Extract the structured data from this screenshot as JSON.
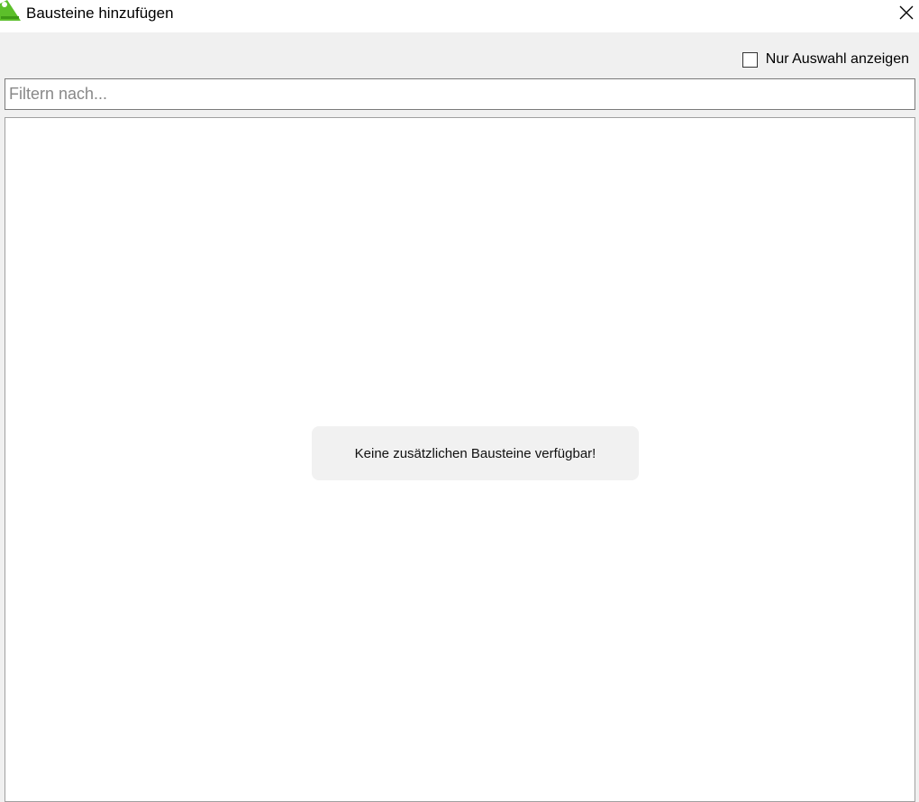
{
  "window": {
    "title": "Bausteine hinzufügen",
    "app_icon": "codesys-logo-icon",
    "close_icon": "close-icon"
  },
  "options": {
    "show_selection_only_label": "Nur Auswahl anzeigen",
    "show_selection_only_checked": false
  },
  "filter": {
    "placeholder": "Filtern nach...",
    "value": ""
  },
  "list": {
    "empty_message": "Keine zusätzlichen Bausteine verfügbar!"
  },
  "colors": {
    "app_icon_green": "#5cbf2a",
    "background": "#f0f0f0"
  }
}
